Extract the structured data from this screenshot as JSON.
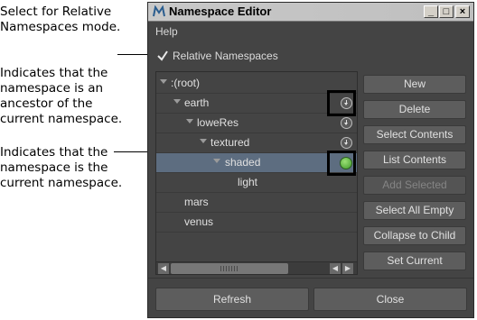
{
  "annotations": {
    "relative_mode": "Select for Relative\nNamespaces mode.",
    "ancestor": "Indicates that the\nnamespace is an\nancestor of the\ncurrent namespace.",
    "current": "Indicates that the\nnamespace is the\ncurrent namespace."
  },
  "window": {
    "title": "Namespace Editor",
    "menu": [
      "Help"
    ]
  },
  "relative_namespaces": {
    "label": "Relative Namespaces",
    "checked": true
  },
  "tree": {
    "root": ":(root)",
    "earth": "earth",
    "loweres": "loweRes",
    "textured": "textured",
    "shaded": "shaded",
    "light": "light",
    "mars": "mars",
    "venus": "venus"
  },
  "buttons": {
    "new": "New",
    "delete": "Delete",
    "select_contents": "Select Contents",
    "list_contents": "List Contents",
    "add_selected": "Add Selected",
    "select_all_empty": "Select All Empty",
    "collapse_to_child": "Collapse to Child",
    "set_current": "Set Current",
    "refresh": "Refresh",
    "close": "Close"
  },
  "colors": {
    "window_bg": "#444444",
    "selected_row": "#5d6d80",
    "current_indicator": "#5cc23a"
  }
}
